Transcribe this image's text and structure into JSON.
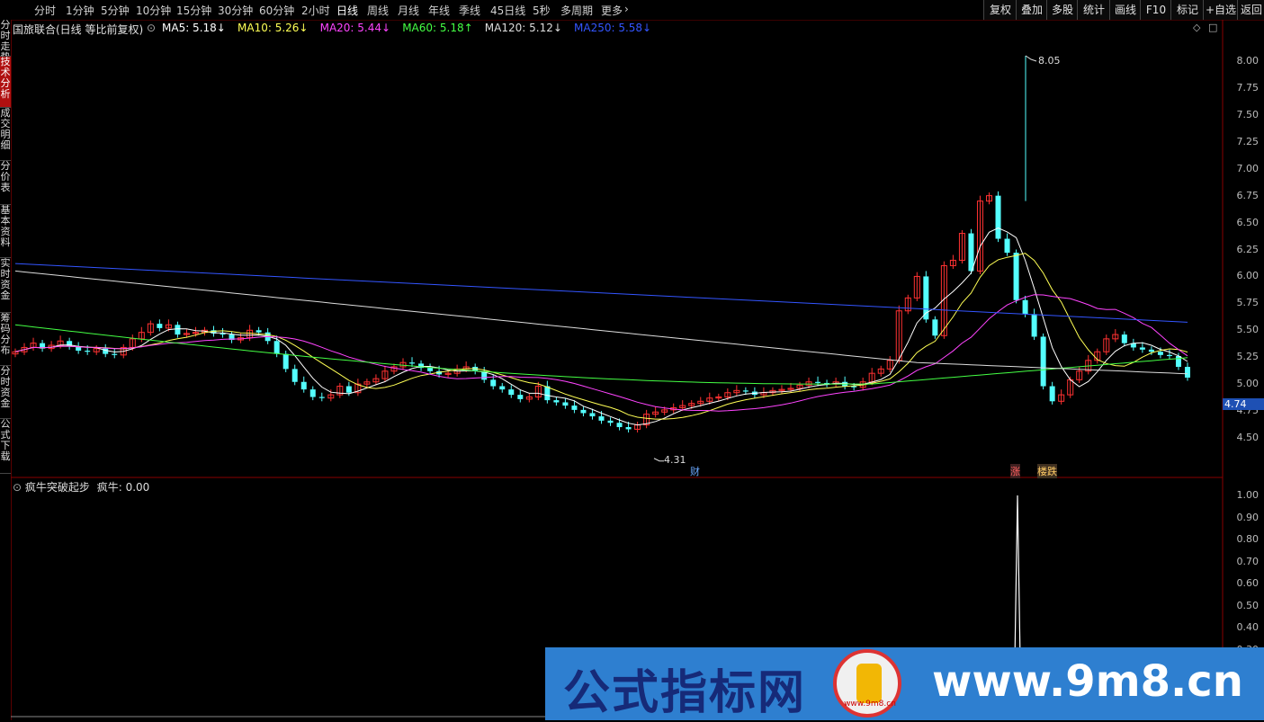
{
  "toolbar": {
    "timeframes": [
      "分时",
      "1分钟",
      "5分钟",
      "10分钟",
      "15分钟",
      "30分钟",
      "60分钟",
      "2小时",
      "日线",
      "周线",
      "月线",
      "年线",
      "季线",
      "45日线",
      "5秒",
      "多周期",
      "更多"
    ],
    "active_timeframe": "日线",
    "more_icon": "chevron-right-icon",
    "right_buttons": [
      "复权",
      "叠加",
      "多股",
      "统计",
      "画线",
      "F10",
      "标记",
      "+自选",
      "返回"
    ]
  },
  "sidebar": {
    "tabs": [
      "分时走势",
      "技术分析",
      "成交明细",
      "分价表",
      "基本资料",
      "实时资金",
      "筹码分布",
      "分时资金",
      "公式下载"
    ],
    "active_tab": "技术分析"
  },
  "main_chart": {
    "stock_name": "国旅联合(日线 等比前复权)",
    "ma_legend": [
      {
        "label": "MA5: 5.18",
        "arrow": "↓",
        "color": "#ffffff"
      },
      {
        "label": "MA10: 5.26",
        "arrow": "↓",
        "color": "#ffff55"
      },
      {
        "label": "MA20: 5.44",
        "arrow": "↓",
        "color": "#ff44ff"
      },
      {
        "label": "MA60: 5.18",
        "arrow": "↑",
        "color": "#44ff44"
      },
      {
        "label": "MA120: 5.12",
        "arrow": "↓",
        "color": "#dddddd"
      },
      {
        "label": "MA250: 5.58",
        "arrow": "↓",
        "color": "#3355ff"
      }
    ],
    "y_ticks": [
      "8.00",
      "7.75",
      "7.50",
      "7.25",
      "7.00",
      "6.75",
      "6.50",
      "6.25",
      "6.00",
      "5.75",
      "5.50",
      "5.25",
      "5.00",
      "4.75",
      "4.50"
    ],
    "current_price": "4.74",
    "high_label": "8.05",
    "low_label": "4.31",
    "markers": {
      "cai": "财",
      "zhang": "涨",
      "jiediе": "楼跌"
    },
    "colors": {
      "up": "#ff3232",
      "down": "#54ffff"
    }
  },
  "indicator": {
    "title": "疯牛突破起步",
    "value_label": "疯牛: 0.00",
    "y_ticks": [
      "1.00",
      "0.90",
      "0.80",
      "0.70",
      "0.60",
      "0.50",
      "0.40",
      "0.30"
    ]
  },
  "chart_data": {
    "type": "line",
    "title": "疯牛突破起步",
    "series": [
      {
        "name": "疯牛",
        "values": [
          0,
          0,
          0,
          0,
          1.0,
          0,
          0
        ]
      }
    ],
    "ylim": [
      0,
      1.0
    ]
  },
  "watermark": {
    "brand": "公式指标网",
    "url": "www.9m8.cn",
    "logo_text": "www.9m8.cn"
  }
}
